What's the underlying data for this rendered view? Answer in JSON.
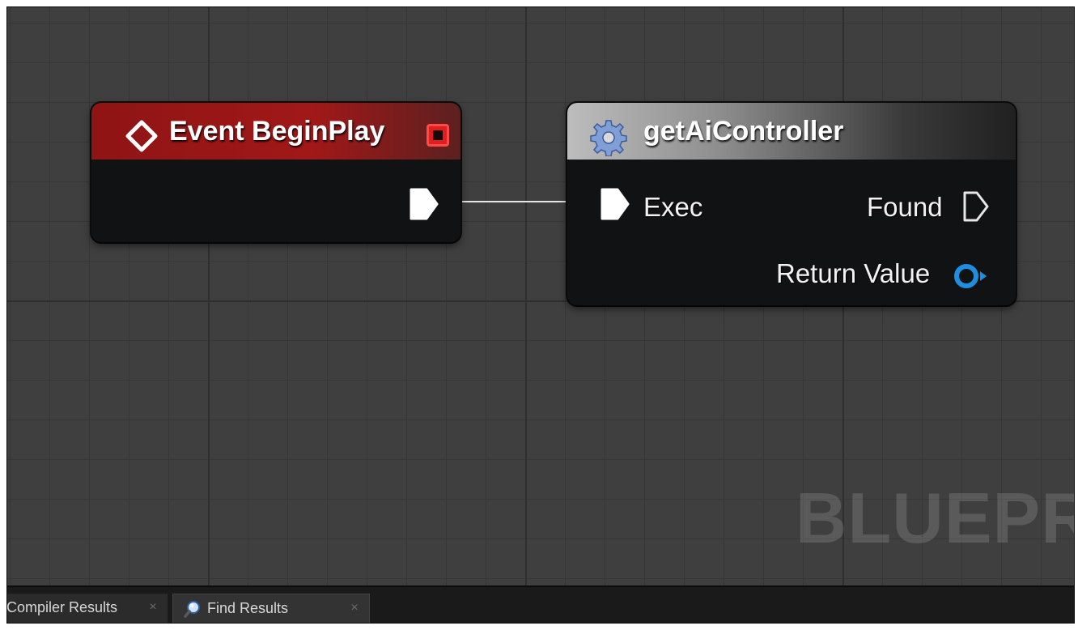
{
  "graph": {
    "watermark": "BLUEPRI"
  },
  "nodes": {
    "event_begin_play": {
      "title": "Event BeginPlay",
      "header_color": "#a11818",
      "icon": "diamond-icon"
    },
    "get_ai_controller": {
      "title": "getAiController",
      "icon": "gear-icon",
      "pins": {
        "exec": "Exec",
        "found": "Found",
        "return_value": "Return Value"
      },
      "return_pin_color": "#1e8fe0"
    }
  },
  "tabs": [
    {
      "label": "Compiler Results",
      "icon": "",
      "active": false
    },
    {
      "label": "Find Results",
      "icon": "search-icon",
      "active": true
    }
  ]
}
